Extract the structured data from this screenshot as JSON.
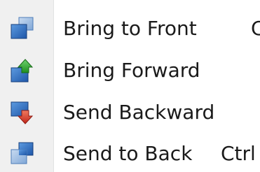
{
  "menu": {
    "items": [
      {
        "label": "Bring to Front",
        "shortcut": "C",
        "icon": "bring-to-front-icon"
      },
      {
        "label": "Bring Forward",
        "shortcut": "",
        "icon": "bring-forward-icon"
      },
      {
        "label": "Send Backward",
        "shortcut": "",
        "icon": "send-backward-icon"
      },
      {
        "label": "Send to Back",
        "shortcut": "Ctrl",
        "icon": "send-to-back-icon"
      }
    ],
    "colors": {
      "square_front": "#2a6fc3",
      "square_back": "#8eb3de",
      "arrow_up": "#2ca02c",
      "arrow_down": "#d9371f",
      "icon_column": "#f0f0f0"
    }
  }
}
